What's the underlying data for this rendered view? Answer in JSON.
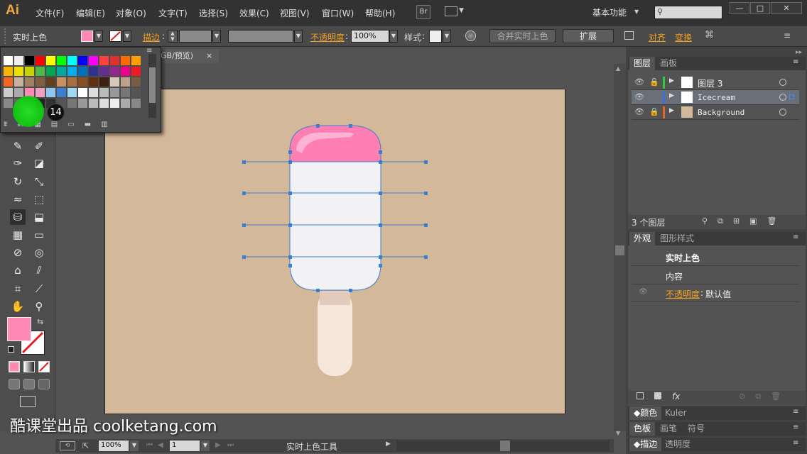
{
  "app": {
    "logo": "Ai"
  },
  "menu": [
    "文件(F)",
    "编辑(E)",
    "对象(O)",
    "文字(T)",
    "选择(S)",
    "效果(C)",
    "视图(V)",
    "窗口(W)",
    "帮助(H)"
  ],
  "menu_br": "Br",
  "workspace": "基本功能",
  "window_controls": [
    "—",
    "□",
    "✕"
  ],
  "control": {
    "tool_name": "实时上色",
    "stroke_label": "描边",
    "opacity_label": "不透明度",
    "opacity_value": "100%",
    "style_label": "样式",
    "merge_button": "合并实时上色",
    "expand_button": "扩展",
    "align_label": "对齐",
    "transform_label": "变换"
  },
  "document": {
    "tab_title": "GB/预览)",
    "tab_close": "×"
  },
  "swatches_popup": {
    "badge": "14"
  },
  "colors": {
    "fill": "#ff88b4",
    "artboard": "#d3b89a",
    "cone_top": "#ff7fb5",
    "body": "#f2f2f4",
    "stick": "#f6e7dd",
    "selection": "#3a7fd0"
  },
  "layers_panel": {
    "tabs": [
      "图层",
      "画板"
    ],
    "layers": [
      {
        "name": "图层 3",
        "color": "#2ecc40"
      },
      {
        "name": "Icecream",
        "color": "#3a6fe0"
      },
      {
        "name": "Background",
        "color": "#e0662a"
      }
    ],
    "count": "3 个图层"
  },
  "appearance_panel": {
    "tabs": [
      "外观",
      "图形样式"
    ],
    "title": "实时上色",
    "content_label": "内容",
    "opacity_label": "不透明度",
    "opacity_value": "默认值",
    "footer_fx": "fx"
  },
  "collapsed_panels": [
    {
      "tabs": [
        "颜色",
        "Kuler"
      ]
    },
    {
      "tabs": [
        "色板",
        "画笔",
        "符号"
      ]
    },
    {
      "tabs": [
        "描边",
        "透明度"
      ]
    }
  ],
  "status": {
    "zoom": "100%",
    "page": "1",
    "tool_name": "实时上色工具"
  },
  "watermark": "酷课堂出品 coolketang.com"
}
